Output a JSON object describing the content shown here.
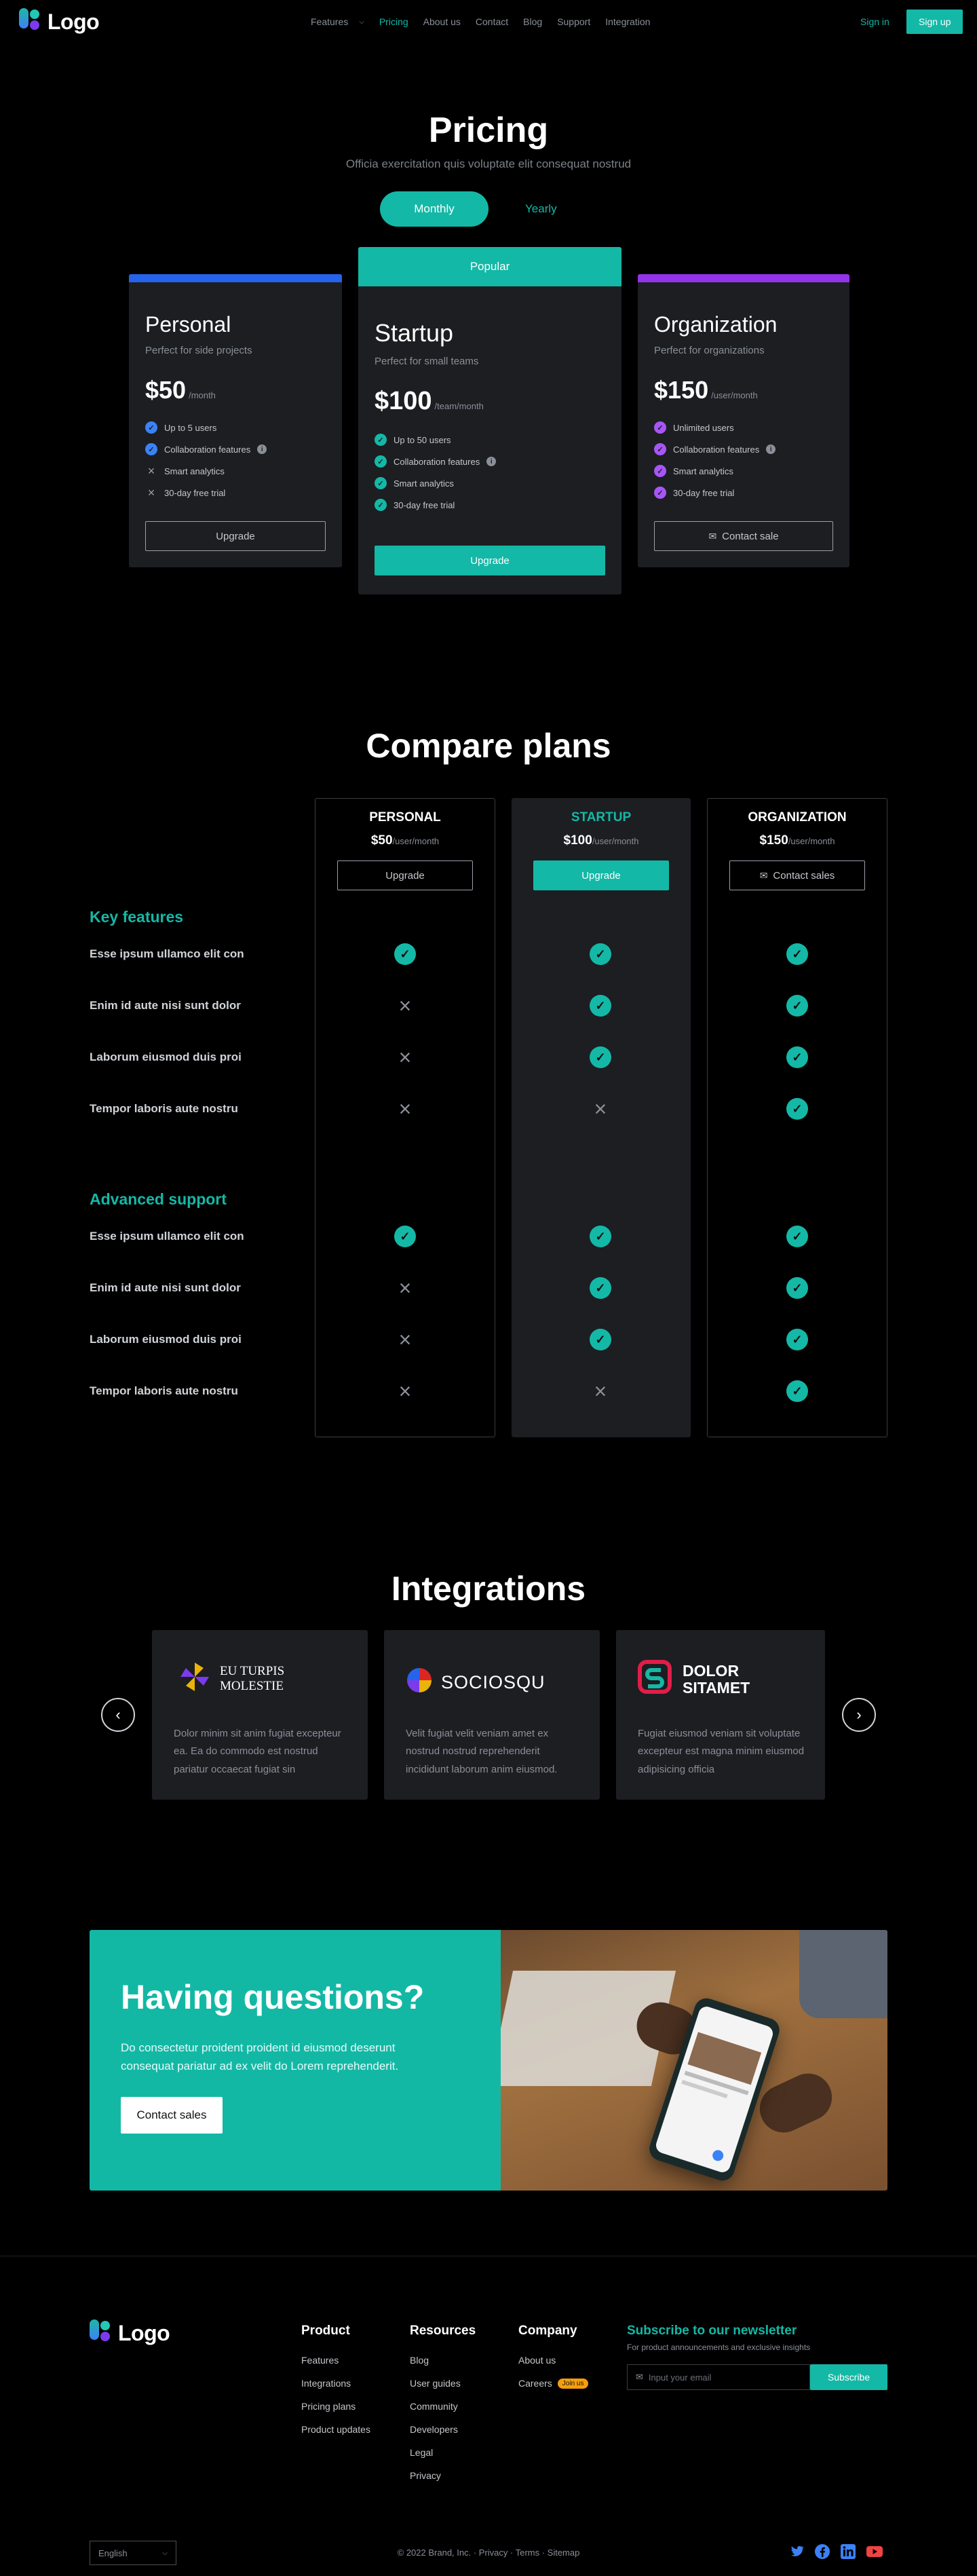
{
  "nav": {
    "logo_text": "Logo",
    "links": [
      "Features",
      "Pricing",
      "About us",
      "Contact",
      "Blog",
      "Support",
      "Integration"
    ],
    "sign_in": "Sign in",
    "sign_up": "Sign up"
  },
  "pricing": {
    "title": "Pricing",
    "subtitle": "Officia exercitation quis voluptate elit consequat nostrud",
    "toggle_monthly": "Monthly",
    "toggle_yearly": "Yearly",
    "plans": [
      {
        "name": "Personal",
        "desc": "Perfect for side projects",
        "price": "$50",
        "per": "/month",
        "accent": "#2563eb",
        "features": [
          "Up to 5 users",
          "Collaboration features",
          "Smart analytics",
          "30-day free trial"
        ],
        "button": "Upgrade"
      },
      {
        "badge": "Popular",
        "name": "Startup",
        "desc": "Perfect for small teams",
        "price": "$100",
        "per": "/team/month",
        "accent": "#14b8a6",
        "features": [
          "Up to 50 users",
          "Collaboration features",
          "Smart analytics",
          "30-day free trial"
        ],
        "button": "Upgrade"
      },
      {
        "name": "Organization",
        "desc": "Perfect for organizations",
        "price": "$150",
        "per": "/user/month",
        "accent": "#9333ea",
        "features": [
          "Unlimited users",
          "Collaboration features",
          "Smart analytics",
          "30-day free trial"
        ],
        "button": "Contact sale"
      }
    ]
  },
  "compare": {
    "title": "Compare plans",
    "columns": [
      {
        "name": "PERSONAL",
        "price": "$50",
        "per": "/user/month",
        "button": "Upgrade"
      },
      {
        "name": "STARTUP",
        "price": "$100",
        "per": "/user/month",
        "button": "Upgrade"
      },
      {
        "name": "ORGANIZATION",
        "price": "$150",
        "per": "/user/month",
        "button": "Contact sales"
      }
    ],
    "sections": [
      {
        "title": "Key features",
        "rows": [
          "Esse ipsum ullamco elit con",
          "Enim id aute nisi sunt dolor",
          "Laborum eiusmod duis proi",
          "Tempor laboris aute nostru"
        ]
      },
      {
        "title": "Advanced support",
        "rows": [
          "Esse ipsum ullamco elit con",
          "Enim id aute nisi sunt dolor",
          "Laborum eiusmod duis proi",
          "Tempor laboris aute nostru"
        ]
      }
    ]
  },
  "integrations": {
    "title": "Integrations",
    "cards": [
      {
        "name_line1": "EU TURPIS",
        "name_line2": "MOLESTIE",
        "text": "Dolor minim sit anim fugiat excepteur ea. Ea do commodo est nostrud pariatur occaecat fugiat sin"
      },
      {
        "name_line1": "SOCIOSQU",
        "name_line2": "",
        "text": "Velit fugiat velit veniam amet ex nostrud nostrud reprehenderit incididunt laborum anim eiusmod."
      },
      {
        "name_line1": "DOLOR",
        "name_line2": "SITAMET",
        "text": "Fugiat eiusmod veniam sit voluptate excepteur est magna minim eiusmod adipisicing officia"
      }
    ]
  },
  "cta": {
    "title": "Having questions?",
    "text": "Do consectetur proident proident id eiusmod deserunt consequat pariatur ad ex velit do Lorem reprehenderit.",
    "button": "Contact sales"
  },
  "footer": {
    "logo_text": "Logo",
    "product": {
      "title": "Product",
      "links": [
        "Features",
        "Integrations",
        "Pricing plans",
        "Product updates"
      ]
    },
    "resources": {
      "title": "Resources",
      "links": [
        "Blog",
        "User guides",
        "Community",
        "Developers",
        "Legal",
        "Privacy"
      ]
    },
    "company": {
      "title": "Company",
      "links": [
        "About us",
        "Careers"
      ],
      "badge": "Join us"
    },
    "newsletter": {
      "title": "Subscribe to our newsletter",
      "subtitle": "For product announcements and exclusive insights",
      "placeholder": "Input your email",
      "button": "Subscribe"
    },
    "language": "English",
    "copyright": "© 2022 Brand, Inc. · Privacy · Terms · Sitemap"
  },
  "colors": {
    "accent": "#14b8a6",
    "blue": "#2563eb",
    "purple": "#9333ea"
  }
}
